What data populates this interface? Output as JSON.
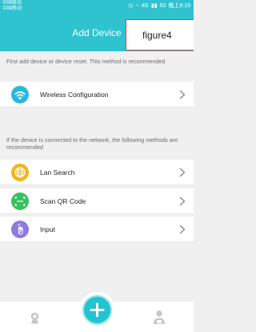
{
  "statusbar": {
    "carrier": "中国移动\n中国移动",
    "signal_text": "4G",
    "battery": "50",
    "time_text": "晚上8:19"
  },
  "header": {
    "title": "Add Device"
  },
  "overlay": {
    "figure_label": "figure4"
  },
  "sections": {
    "first_note": "First add device or device reset. This method is recommended",
    "second_note": "If the device is connected to the network, the following methods are recommended"
  },
  "items": [
    {
      "label": "Wireless Configuration",
      "icon": "wifi-icon"
    },
    {
      "label": "Lan Search",
      "icon": "globe-icon"
    },
    {
      "label": "Scan QR Code",
      "icon": "scan-icon"
    },
    {
      "label": "Input",
      "icon": "touch-icon"
    }
  ],
  "colors": {
    "accent": "#2fc2cf",
    "wireless": "#29b7df",
    "lan": "#f3b51a",
    "scan": "#38c25f",
    "input": "#8b7ce0"
  }
}
